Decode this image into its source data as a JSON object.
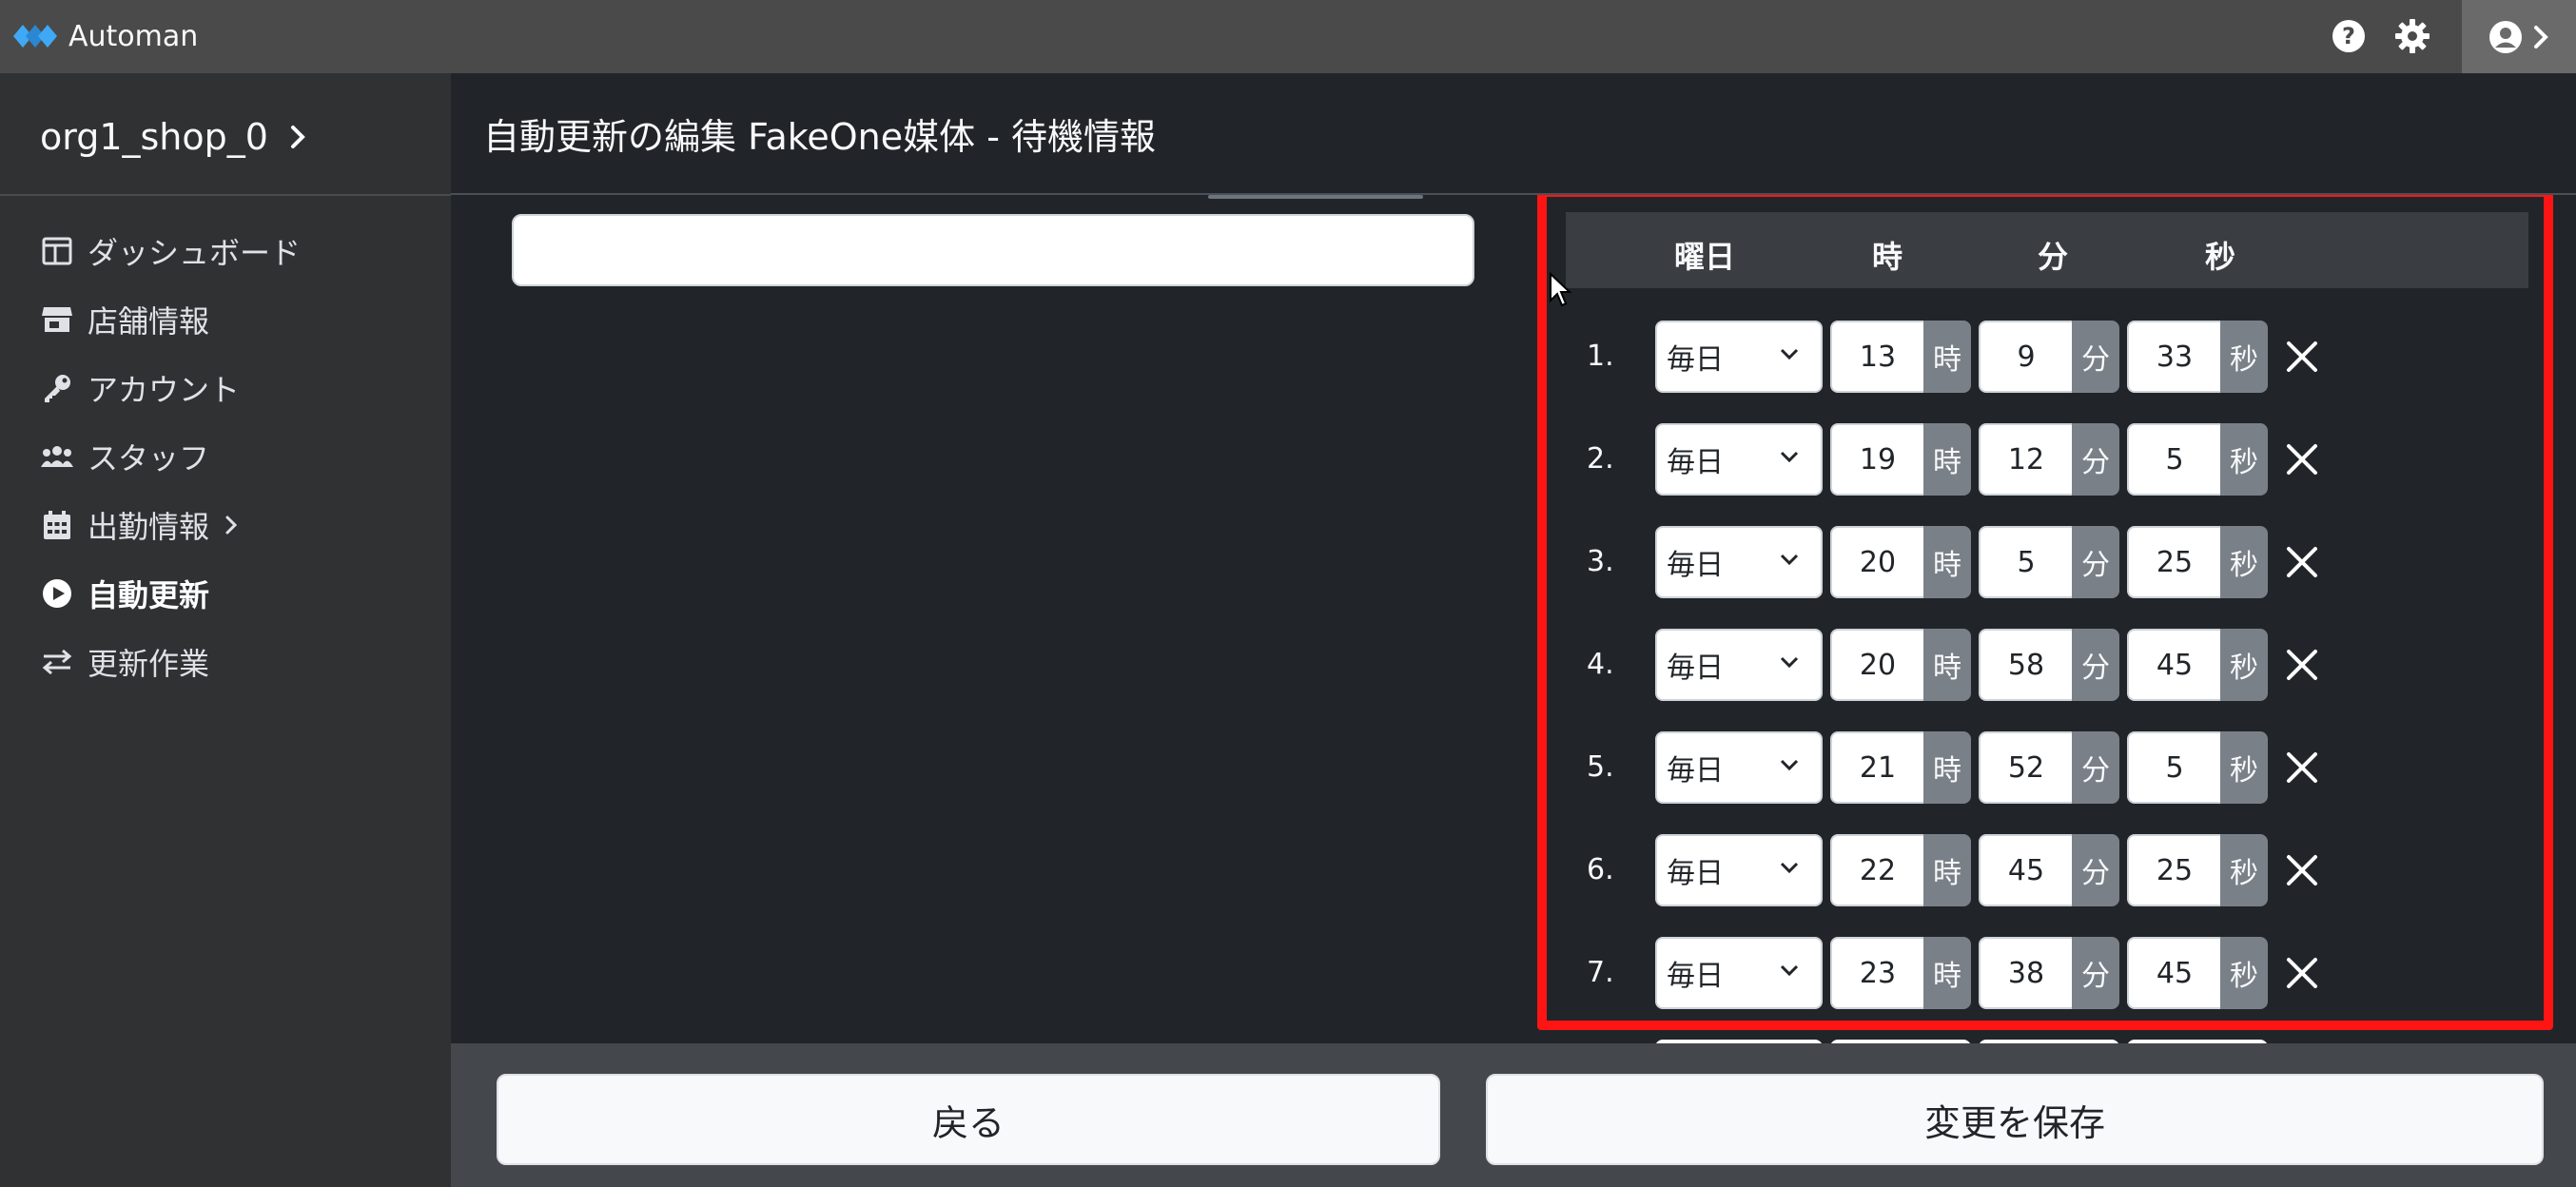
{
  "app": {
    "name": "Automan"
  },
  "colors": {
    "highlight": "#ff1414",
    "topbar": "#4a4a4a",
    "sidebar": "#303133",
    "content": "#212529"
  },
  "topbar": {
    "icons": [
      "help-icon",
      "gear-icon",
      "user-circle-icon",
      "chevron-right-icon"
    ]
  },
  "sidebar": {
    "shop": "org1_shop_0",
    "items": [
      {
        "label": "ダッシュボード",
        "icon": "dashboard-icon"
      },
      {
        "label": "店舗情報",
        "icon": "store-icon"
      },
      {
        "label": "アカウント",
        "icon": "key-icon"
      },
      {
        "label": "スタッフ",
        "icon": "users-icon"
      },
      {
        "label": "出勤情報",
        "icon": "calendar-icon"
      },
      {
        "label": "自動更新",
        "icon": "play-circle-icon",
        "active": true
      },
      {
        "label": "更新作業",
        "icon": "exchange-icon"
      }
    ]
  },
  "header": {
    "title": "自動更新の編集 FakeOne媒体 - 待機情報"
  },
  "main": {
    "input_value": ""
  },
  "schedule": {
    "headers": {
      "day": "曜日",
      "hour": "時",
      "minute": "分",
      "second": "秒"
    },
    "units": {
      "hour": "時",
      "minute": "分",
      "second": "秒"
    },
    "rows": [
      {
        "num": "1.",
        "day": "毎日",
        "hour": "13",
        "minute": "9",
        "second": "33"
      },
      {
        "num": "2.",
        "day": "毎日",
        "hour": "19",
        "minute": "12",
        "second": "5"
      },
      {
        "num": "3.",
        "day": "毎日",
        "hour": "20",
        "minute": "5",
        "second": "25"
      },
      {
        "num": "4.",
        "day": "毎日",
        "hour": "20",
        "minute": "58",
        "second": "45"
      },
      {
        "num": "5.",
        "day": "毎日",
        "hour": "21",
        "minute": "52",
        "second": "5"
      },
      {
        "num": "6.",
        "day": "毎日",
        "hour": "22",
        "minute": "45",
        "second": "25"
      },
      {
        "num": "7.",
        "day": "毎日",
        "hour": "23",
        "minute": "38",
        "second": "45"
      }
    ]
  },
  "footer": {
    "back_label": "戻る",
    "save_label": "変更を保存"
  }
}
